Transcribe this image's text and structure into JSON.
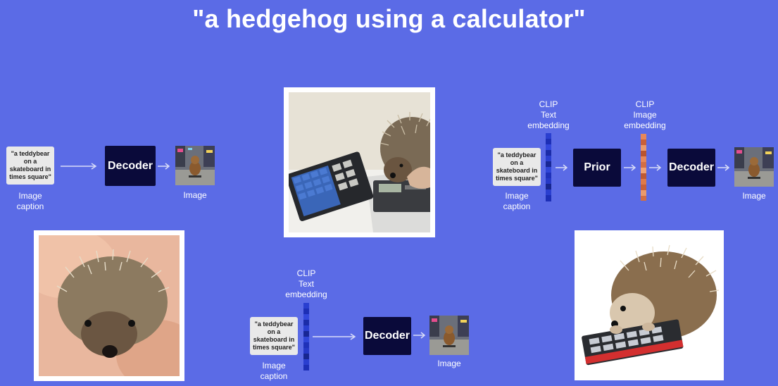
{
  "title": "\"a hedgehog using a calculator\"",
  "caption_text": "\"a teddybear on a skateboard in times square\"",
  "labels": {
    "image_caption": "Image\ncaption",
    "image": "Image",
    "decoder": "Decoder",
    "prior": "Prior",
    "clip_text_embedding": "CLIP\nText\nembedding",
    "clip_image_embedding": "CLIP\nImage\nembedding"
  },
  "colors": {
    "background": "#5B6BE6",
    "block": "#0A0A3A",
    "text_embedding": "#2233C8",
    "image_embedding": "#E07A4A"
  }
}
